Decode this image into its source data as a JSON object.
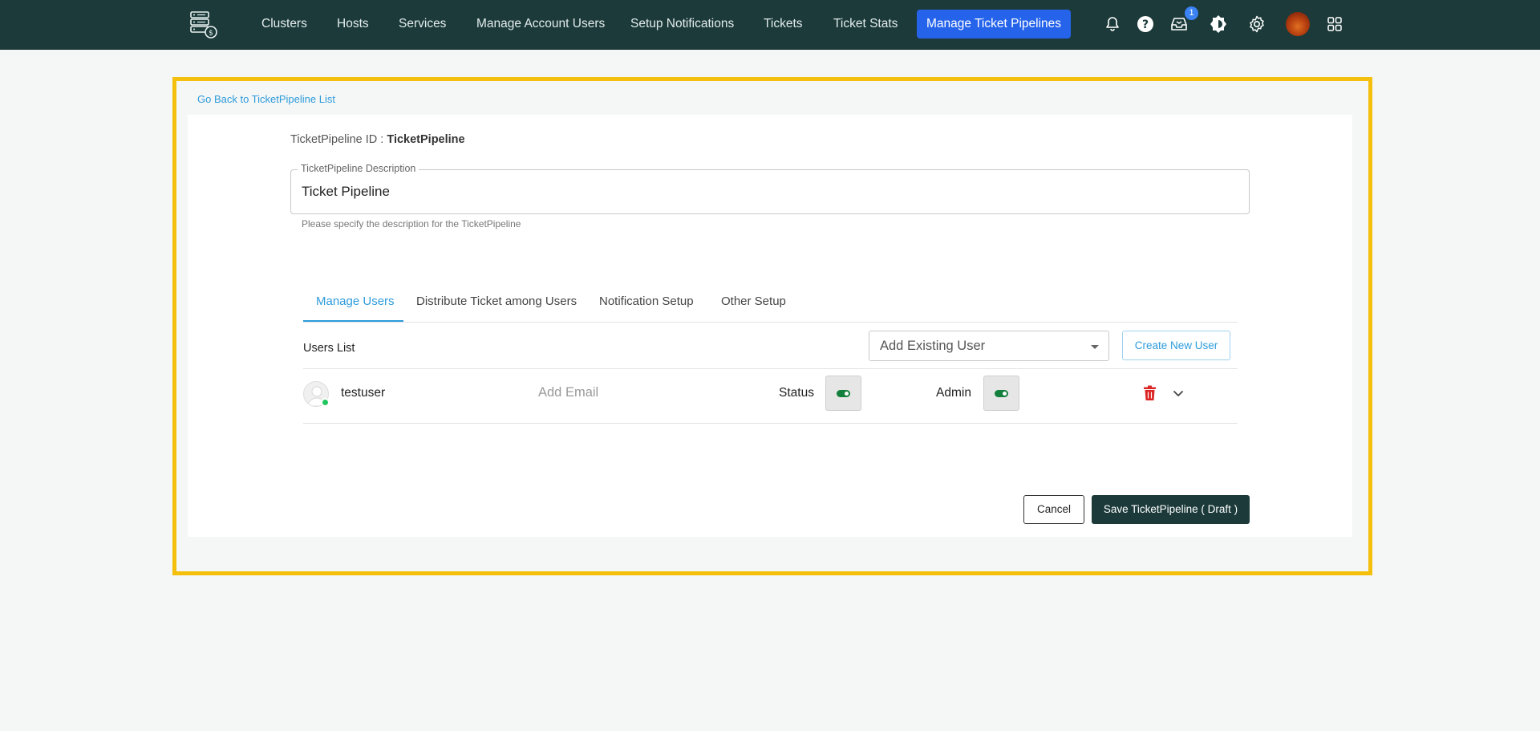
{
  "nav": {
    "items": [
      {
        "label": "Clusters"
      },
      {
        "label": "Hosts"
      },
      {
        "label": "Services"
      },
      {
        "label": "Manage Account Users"
      },
      {
        "label": "Setup Notifications"
      },
      {
        "label": "Tickets"
      },
      {
        "label": "Ticket Stats"
      },
      {
        "label": "Manage Ticket Pipelines"
      }
    ],
    "inbox_badge": "1",
    "colors": {
      "bar": "#1c3a3a",
      "active": "#2563eb"
    }
  },
  "back_link": "Go Back to TicketPipeline List",
  "pipeline": {
    "id_label": "TicketPipeline ID :",
    "id_value": "TicketPipeline",
    "description_label": "TicketPipeline Description",
    "description_value": "Ticket Pipeline",
    "description_help": "Please specify the description for the TicketPipeline"
  },
  "tabs": [
    {
      "label": "Manage Users"
    },
    {
      "label": "Distribute Ticket among Users"
    },
    {
      "label": "Notification Setup"
    },
    {
      "label": "Other Setup"
    }
  ],
  "users": {
    "title": "Users List",
    "add_existing_placeholder": "Add Existing User",
    "create_new_label": "Create New User",
    "rows": [
      {
        "name": "testuser",
        "email_placeholder": "Add Email",
        "status_label": "Status",
        "admin_label": "Admin"
      }
    ]
  },
  "footer": {
    "cancel_label": "Cancel",
    "save_label": "Save TicketPipeline ( Draft )"
  }
}
